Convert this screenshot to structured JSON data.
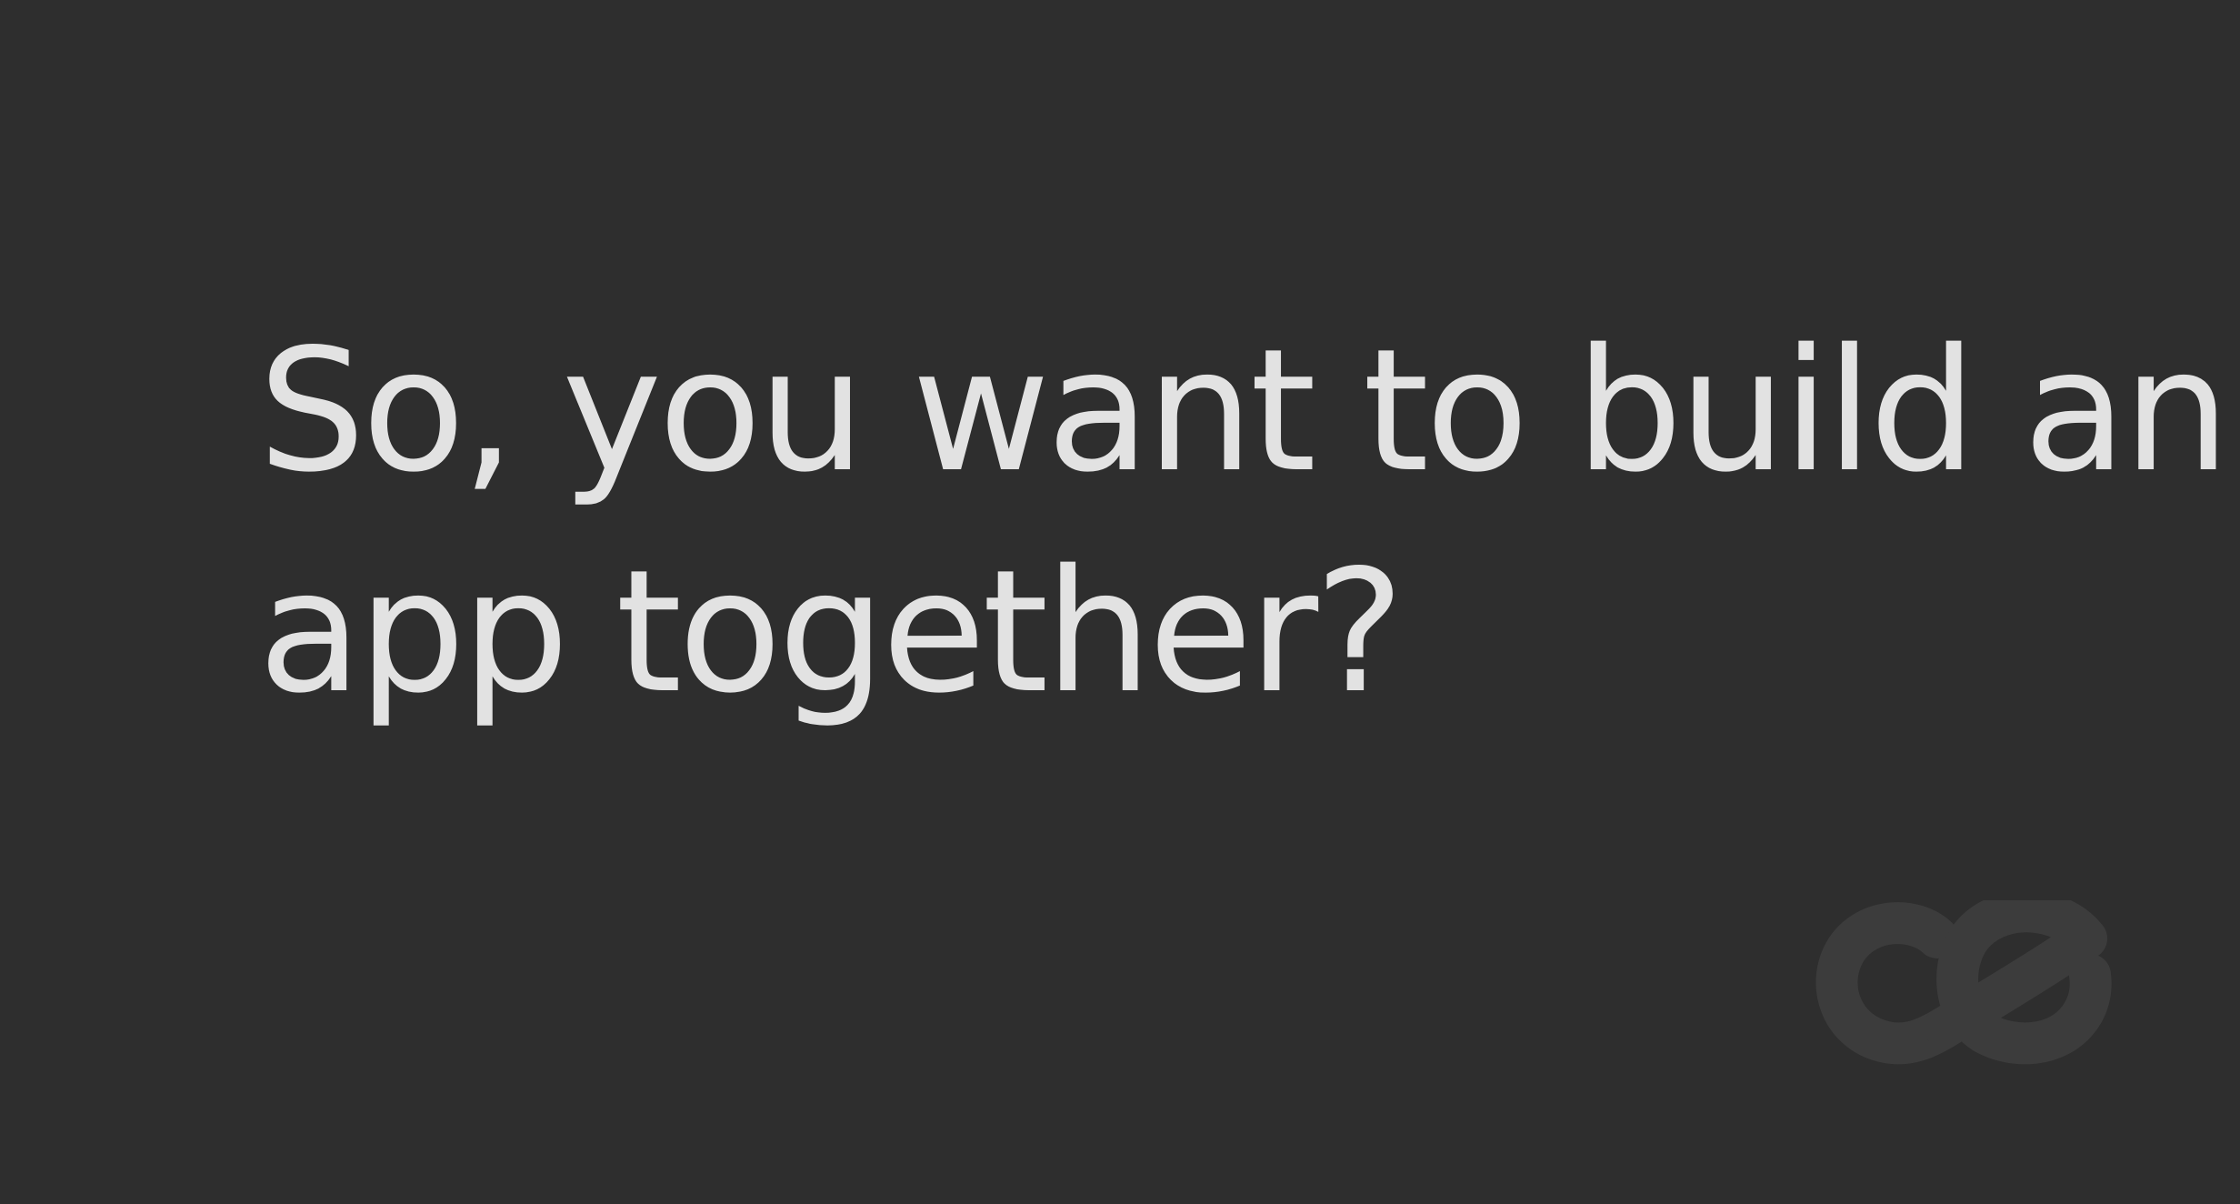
{
  "slide": {
    "headline_line1": "So, you want to build an",
    "headline_line2": "app together?"
  },
  "logo": {
    "icon": "ce-logo-icon",
    "color": "#3c3c3c"
  },
  "colors": {
    "background": "#2e2e2e",
    "text": "#e2e2e2"
  }
}
